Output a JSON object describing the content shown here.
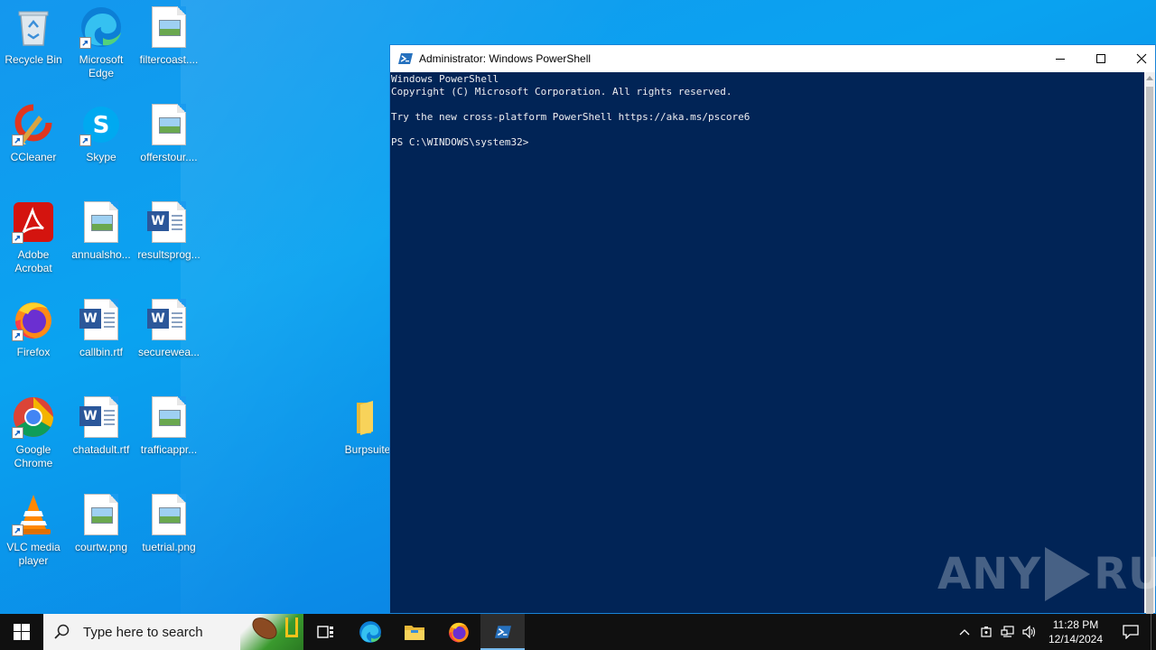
{
  "desktop": {
    "icons": [
      {
        "label": "Recycle Bin",
        "icon": "recycle-bin-icon"
      },
      {
        "label": "Microsoft Edge",
        "icon": "edge-icon"
      },
      {
        "label": "filtercoast....",
        "icon": "image-file-icon"
      },
      {
        "label": "CCleaner",
        "icon": "ccleaner-icon"
      },
      {
        "label": "Skype",
        "icon": "skype-icon"
      },
      {
        "label": "offerstour....",
        "icon": "image-file-icon"
      },
      {
        "label": "Adobe Acrobat",
        "icon": "acrobat-icon"
      },
      {
        "label": "annualsho...",
        "icon": "image-file-icon"
      },
      {
        "label": "resultsprog...",
        "icon": "word-doc-icon"
      },
      {
        "label": "Firefox",
        "icon": "firefox-icon"
      },
      {
        "label": "callbin.rtf",
        "icon": "word-doc-icon"
      },
      {
        "label": "securewea...",
        "icon": "word-doc-icon"
      },
      {
        "label": "Google Chrome",
        "icon": "chrome-icon"
      },
      {
        "label": "chatadult.rtf",
        "icon": "word-doc-icon"
      },
      {
        "label": "trafficappr...",
        "icon": "image-file-icon"
      },
      {
        "label": "VLC media player",
        "icon": "vlc-icon"
      },
      {
        "label": "courtw.png",
        "icon": "image-file-icon"
      },
      {
        "label": "tuetrial.png",
        "icon": "image-file-icon"
      },
      {
        "label": "Burpsuite-",
        "icon": "folder-icon"
      }
    ]
  },
  "window": {
    "title": "Administrator: Windows PowerShell",
    "console_lines": [
      "Windows PowerShell",
      "Copyright (C) Microsoft Corporation. All rights reserved.",
      "",
      "Try the new cross-platform PowerShell https://aka.ms/pscore6",
      "",
      "PS C:\\WINDOWS\\system32>"
    ]
  },
  "watermark": {
    "left": "ANY",
    "right": "RUN"
  },
  "taskbar": {
    "search_placeholder": "Type here to search",
    "apps": [
      {
        "name": "task-view",
        "icon": "task-view-icon"
      },
      {
        "name": "edge",
        "icon": "edge-icon"
      },
      {
        "name": "file-explorer",
        "icon": "folder-icon"
      },
      {
        "name": "firefox",
        "icon": "firefox-icon"
      },
      {
        "name": "powershell",
        "icon": "powershell-icon",
        "active": true
      }
    ],
    "clock": {
      "time": "11:28 PM",
      "date": "12/14/2024"
    }
  },
  "colors": {
    "console_bg": "#012456",
    "console_fg": "#eeedf0",
    "taskbar_bg": "#101010",
    "accent": "#1883d7"
  }
}
